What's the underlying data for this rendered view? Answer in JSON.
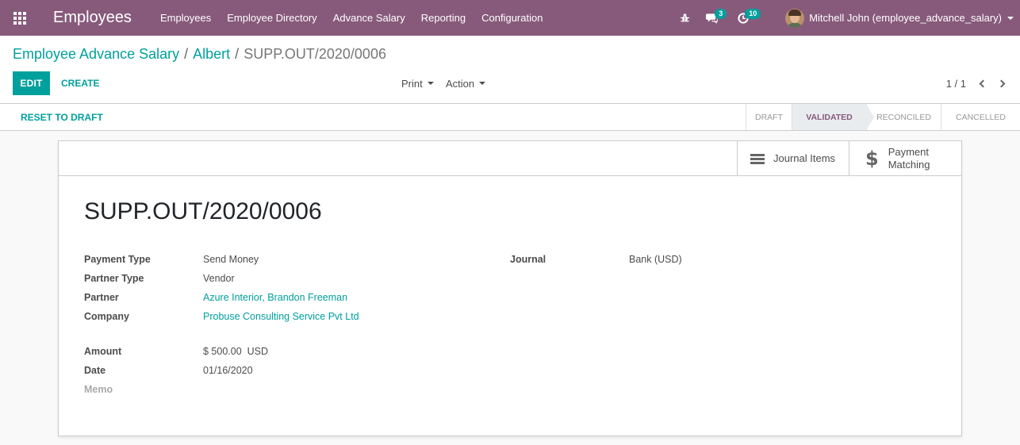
{
  "navbar": {
    "app_name": "Employees",
    "menu": [
      "Employees",
      "Employee Directory",
      "Advance Salary",
      "Reporting",
      "Configuration"
    ],
    "messages_count": "3",
    "activities_count": "10",
    "user_name": "Mitchell John (employee_advance_salary)",
    "color": "#875a7b"
  },
  "breadcrumb": {
    "root": "Employee Advance Salary",
    "parent": "Albert",
    "current": "SUPP.OUT/2020/0006",
    "separator": "/"
  },
  "toolbar": {
    "edit_label": "EDIT",
    "create_label": "CREATE",
    "print_label": "Print",
    "action_label": "Action",
    "pager": "1 / 1"
  },
  "statusbar": {
    "reset_label": "RESET TO DRAFT",
    "stages": [
      "DRAFT",
      "VALIDATED",
      "RECONCILED",
      "CANCELLED"
    ],
    "current_stage": "VALIDATED"
  },
  "smart_buttons": {
    "journal_items": "Journal Items",
    "payment_matching_line1": "Payment",
    "payment_matching_line2": "Matching"
  },
  "record": {
    "title": "SUPP.OUT/2020/0006",
    "payment_type_label": "Payment Type",
    "payment_type": "Send Money",
    "partner_type_label": "Partner Type",
    "partner_type": "Vendor",
    "partner_label": "Partner",
    "partner": "Azure Interior, Brandon Freeman",
    "company_label": "Company",
    "company": "Probuse Consulting Service Pvt Ltd",
    "amount_label": "Amount",
    "amount": "$ 500.00",
    "currency": "USD",
    "date_label": "Date",
    "date": "01/16/2020",
    "memo_label": "Memo",
    "journal_label": "Journal",
    "journal": "Bank (USD)"
  },
  "colors": {
    "accent": "#00a09d",
    "brand": "#875a7b"
  }
}
